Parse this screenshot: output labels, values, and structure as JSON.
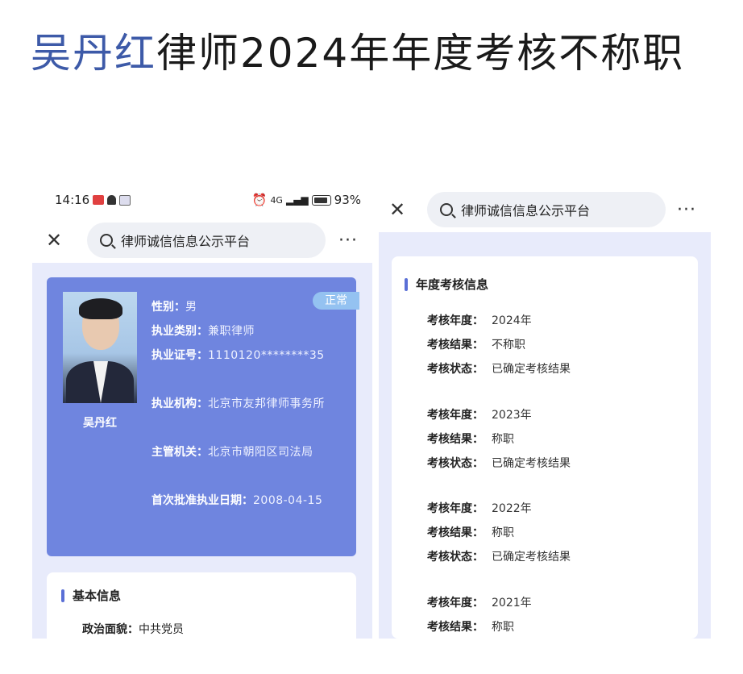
{
  "headline": {
    "name": "吴丹红",
    "rest": "律师2024年年度考核不称职"
  },
  "left_screen": {
    "status": {
      "time": "14:16",
      "battery": "93%",
      "network": "4G"
    },
    "nav": {
      "search_text": "律师诚信信息公示平台",
      "more": "···"
    },
    "profile": {
      "name": "吴丹红",
      "badge": "正常",
      "fields": [
        {
          "label": "性别：",
          "value": "男"
        },
        {
          "label": "执业类别：",
          "value": "兼职律师"
        },
        {
          "label": "执业证号：",
          "value": "1110120********35"
        },
        {
          "label": "执业机构：",
          "value": "北京市友邦律师事务所"
        },
        {
          "label": "主管机关：",
          "value": "北京市朝阳区司法局"
        },
        {
          "label": "首次批准执业日期：",
          "value": "2008-04-15"
        }
      ]
    },
    "basic": {
      "title": "基本信息",
      "row_label": "政治面貌：",
      "row_value": "中共党员"
    }
  },
  "right_screen": {
    "nav": {
      "search_text": "律师诚信信息公示平台",
      "more": "···"
    },
    "annual": {
      "title": "年度考核信息",
      "labels": {
        "year": "考核年度：",
        "result": "考核结果：",
        "status": "考核状态："
      },
      "records": [
        {
          "year": "2024年",
          "result": "不称职",
          "status": "已确定考核结果"
        },
        {
          "year": "2023年",
          "result": "称职",
          "status": "已确定考核结果"
        },
        {
          "year": "2022年",
          "result": "称职",
          "status": "已确定考核结果"
        },
        {
          "year": "2021年",
          "result": "称职"
        }
      ]
    }
  }
}
